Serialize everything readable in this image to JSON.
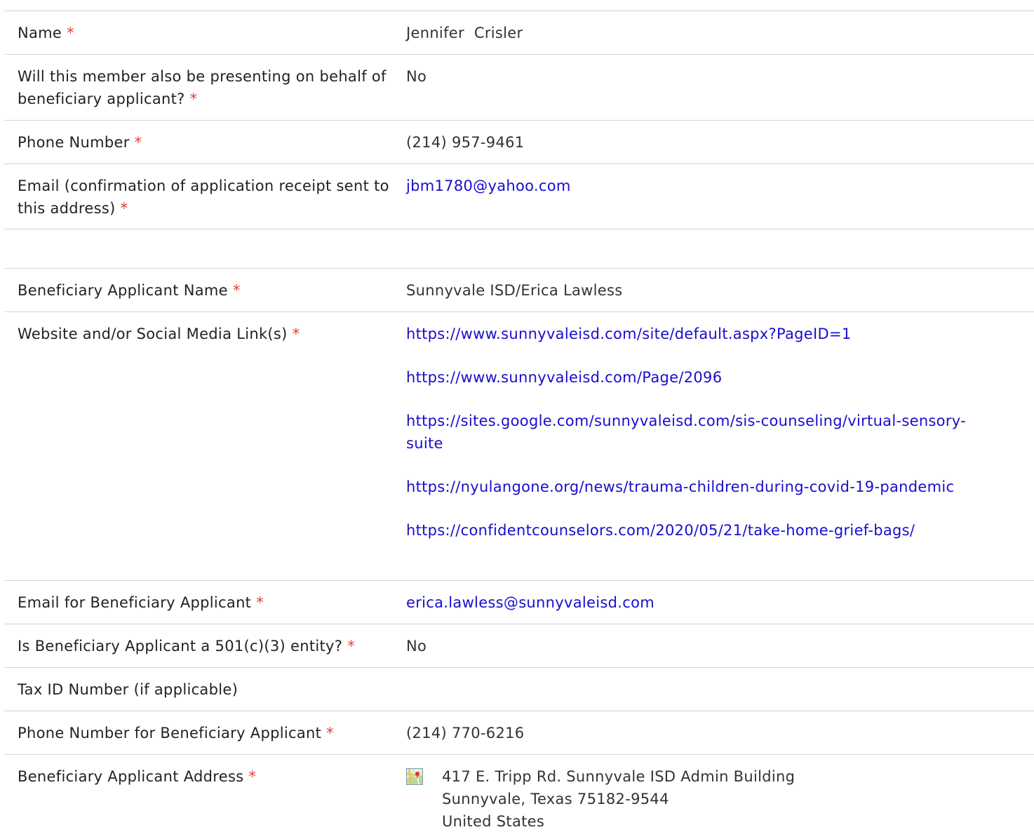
{
  "required_mark": "*",
  "member": {
    "rows": [
      {
        "label": "Name",
        "value": "Jennifer  Crisler"
      },
      {
        "label": "Will this member also be presenting on behalf of beneficiary applicant?",
        "value": "No"
      },
      {
        "label": "Phone Number",
        "value": "(214) 957-9461"
      },
      {
        "label": "Email (confirmation of application receipt sent to this address)",
        "value": "jbm1780@yahoo.com"
      }
    ]
  },
  "beneficiary": {
    "name_label": "Beneficiary Applicant Name",
    "name_value": "Sunnyvale ISD/Erica Lawless",
    "website_label": "Website and/or Social Media Link(s)",
    "links": [
      "https://www.sunnyvaleisd.com/site/default.aspx?PageID=1",
      "https://www.sunnyvaleisd.com/Page/2096",
      "https://sites.google.com/sunnyvaleisd.com/sis-counseling/virtual-sensory-suite",
      "https://nyulangone.org/news/trauma-children-during-covid-19-pandemic",
      "https://confidentcounselors.com/2020/05/21/take-home-grief-bags/"
    ],
    "email_label": "Email for Beneficiary Applicant",
    "email_value": "erica.lawless@sunnyvaleisd.com",
    "c3_label": "Is Beneficiary Applicant a 501(c)(3) entity?",
    "c3_value": "No",
    "taxid_label": "Tax ID Number (if applicable)",
    "taxid_value": "",
    "phone_label": "Phone Number for Beneficiary Applicant",
    "phone_value": "(214) 770-6216",
    "address_label": "Beneficiary Applicant Address",
    "address_icon": "map-icon",
    "address_line1": "417 E. Tripp Rd. Sunnyvale ISD Admin Building",
    "address_line2": "Sunnyvale, Texas 75182-9544",
    "address_line3": "United States"
  },
  "colors": {
    "link": "#1a0dcc",
    "required": "#e0403a",
    "divider": "#d4d4d4"
  }
}
